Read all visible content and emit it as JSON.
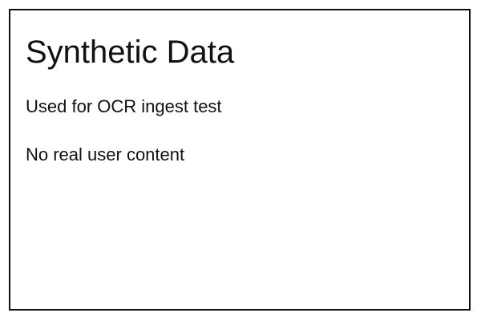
{
  "document": {
    "title": "Synthetic Data",
    "lines": [
      "Used for OCR ingest test",
      "No real user content"
    ]
  },
  "colors": {
    "background": "#ffffff",
    "text": "#111111",
    "border": "#111111"
  }
}
